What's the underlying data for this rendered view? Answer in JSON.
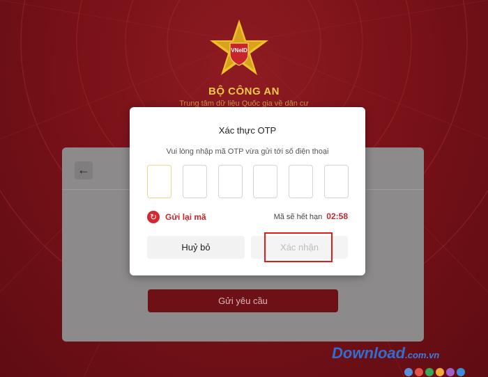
{
  "org": {
    "emblem_text": "VNeID",
    "title": "BỘ CÔNG AN",
    "subtitle": "Trung tâm dữ liệu Quốc gia về dân cư"
  },
  "background_card": {
    "back_icon": "arrow-left-icon",
    "submit_label": "Gửi yêu cầu"
  },
  "modal": {
    "title": "Xác thực OTP",
    "description": "Vui lòng nhập mã OTP vừa gửi tới số điện thoại",
    "otp_digits": [
      "",
      "",
      "",
      "",
      "",
      ""
    ],
    "resend_label": "Gửi lại mã",
    "resend_icon": "refresh-icon",
    "expire_label": "Mã sẽ hết hạn",
    "timer": "02:58",
    "cancel_label": "Huỷ bỏ",
    "confirm_label": "Xác nhận"
  },
  "watermark": {
    "text": "Download",
    "suffix": ".com.vn",
    "dot_colors": [
      "#5a8fd8",
      "#e0524a",
      "#3aa65a",
      "#f0a93a",
      "#a05fc8",
      "#3a8fd8"
    ]
  },
  "colors": {
    "brand_red": "#c2272d",
    "background_red": "#7a1219",
    "gold": "#f3c84a",
    "highlight": "#e01b1b"
  }
}
